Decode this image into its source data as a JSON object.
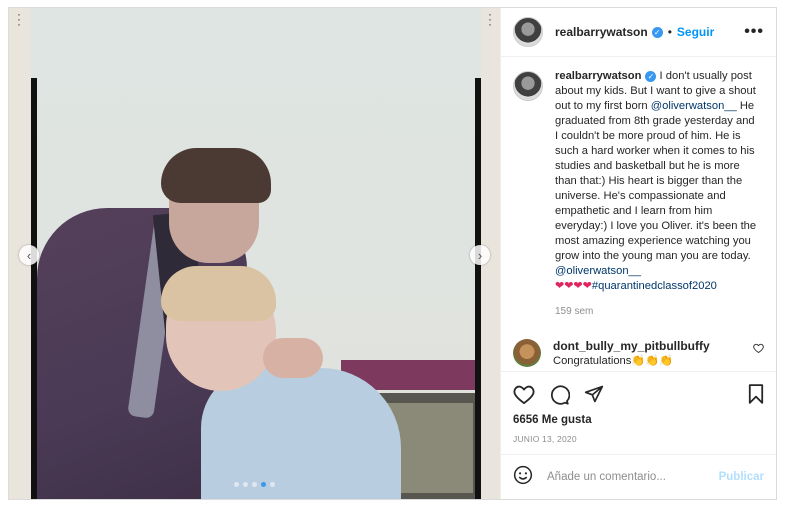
{
  "header": {
    "username": "realbarrywatson",
    "separator": "•",
    "follow_label": "Seguir",
    "more_icon": "more-horizontal-icon",
    "more_label": "•••"
  },
  "caption": {
    "username": "realbarrywatson",
    "text_1": " I don't usually post about my kids. But I want to give a shout out to my first born ",
    "mention_1": "@oliverwatson__",
    "text_2": " He graduated from 8th grade yesterday and I couldn't be more proud of him. He is such a hard worker when it comes to his studies and basketball but he is more than that:) His heart is bigger than the universe. He's compassionate and empathetic and I learn from him everyday:) I love you Oliver. it's been the most amazing experience watching you grow into the young man you are today. ",
    "mention_2": "@oliverwatson__",
    "hearts": "❤❤❤❤",
    "hashtag": "#quarantinedclassof2020",
    "age": "159 sem"
  },
  "comment": {
    "username": "dont_bully_my_pitbullbuffy",
    "text": "Congratulations👏👏👏"
  },
  "actions": {
    "likes": "6656 Me gusta",
    "date": "JUNIO 13, 2020"
  },
  "add_comment": {
    "placeholder": "Añade un comentario...",
    "publish_label": "Publicar"
  },
  "carousel": {
    "prev_label": "‹",
    "next_label": "›",
    "slide_count": 5,
    "active_index": 3
  },
  "colors": {
    "accent": "#0095f6",
    "verified": "#3897f0",
    "publish_disabled": "#b2dffc",
    "heart_red": "#e0245e"
  }
}
